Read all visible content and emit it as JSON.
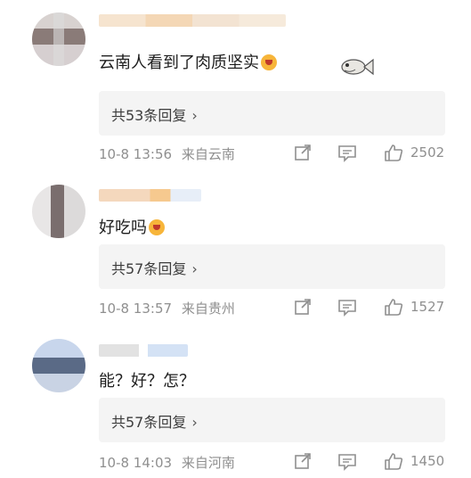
{
  "comments": [
    {
      "text": "云南人看到了肉质坚实",
      "reply_label": "共53条回复",
      "time": "10-8 13:56",
      "location": "来自云南",
      "likes": "2502",
      "emoji": "heart-eyes-emoji-icon",
      "sticker": "fish-sticker-icon"
    },
    {
      "text": "好吃吗",
      "reply_label": "共57条回复",
      "time": "10-8 13:57",
      "location": "来自贵州",
      "likes": "1527",
      "emoji": "scared-emoji-icon"
    },
    {
      "text": "能？好？怎？",
      "reply_label": "共57条回复",
      "time": "10-8 14:03",
      "location": "来自河南",
      "likes": "1450"
    }
  ],
  "chevron": "›",
  "colors": {
    "meta_text": "#8f8f8f",
    "reply_bg": "#f4f4f4",
    "emoji": "#f7b53a"
  }
}
